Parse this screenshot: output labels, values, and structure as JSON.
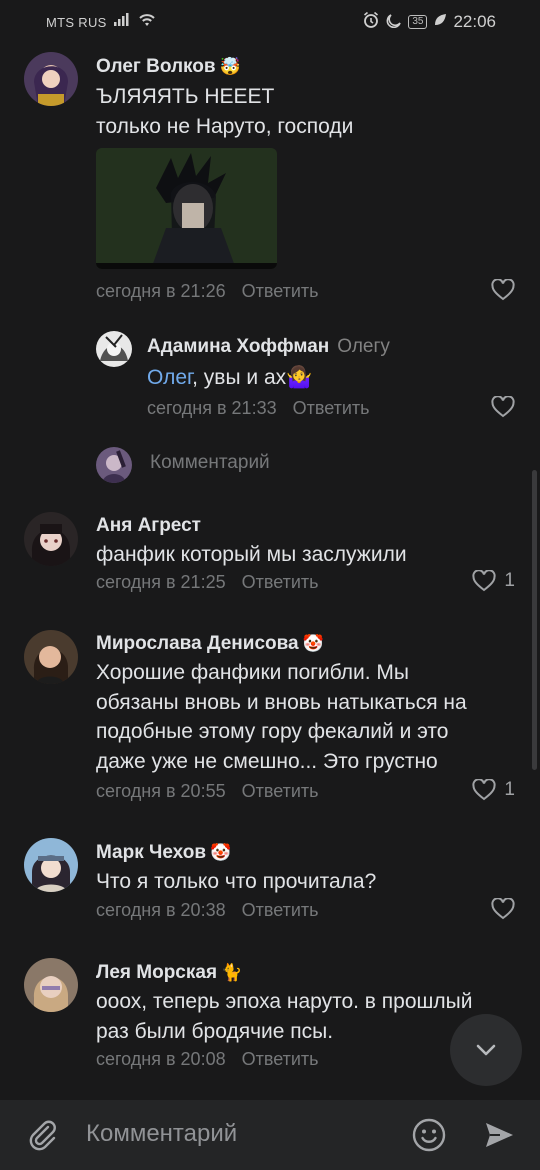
{
  "status_bar": {
    "carrier": "MTS RUS",
    "battery": "35",
    "time": "22:06"
  },
  "comments": [
    {
      "author": "Олег Волков",
      "author_emoji": "🤯",
      "text_lines": [
        "ЪЛЯЯЯТЬ НЕЕЕТ",
        "только не Наруто, господи"
      ],
      "has_photo": true,
      "time": "сегодня в 21:26",
      "reply_label": "Ответить",
      "likes": ""
    },
    {
      "author": "Адамина Хоффман",
      "reply_to": "Олегу",
      "mention": "Олег",
      "text": ", увы и ах",
      "text_emoji": "🤷‍♀️",
      "time": "сегодня в 21:33",
      "reply_label": "Ответить",
      "likes": ""
    },
    {
      "author": "Аня Агрест",
      "text": "фанфик который мы заслужили",
      "time": "сегодня в 21:25",
      "reply_label": "Ответить",
      "likes": "1"
    },
    {
      "author": "Мирослава Денисова",
      "author_emoji": "🤡",
      "text_lines": [
        "Хорошие фанфики погибли. Мы",
        "обязаны вновь и вновь натыкаться на",
        "подобные этому гору фекалий и это",
        "даже уже не смешно... Это грустно"
      ],
      "time": "сегодня в 20:55",
      "reply_label": "Ответить",
      "likes": "1"
    },
    {
      "author": "Марк Чехов",
      "author_emoji": "🤡",
      "text": "Что я только что прочитала?",
      "time": "сегодня в 20:38",
      "reply_label": "Ответить",
      "likes": ""
    },
    {
      "author": "Лея Морская",
      "author_emoji": "🐈",
      "text_lines": [
        "ооох, теперь эпоха наруто. в прошлый",
        "раз были бродячие псы."
      ],
      "time": "сегодня в 20:08",
      "reply_label": "Ответить",
      "likes": ""
    }
  ],
  "thread_reply_placeholder": "Комментарий",
  "composer": {
    "placeholder": "Комментарий"
  },
  "colors": {
    "background": "#19191a",
    "text": "#e1e3e6",
    "secondary": "#76787a",
    "accent": "#71aaeb"
  }
}
